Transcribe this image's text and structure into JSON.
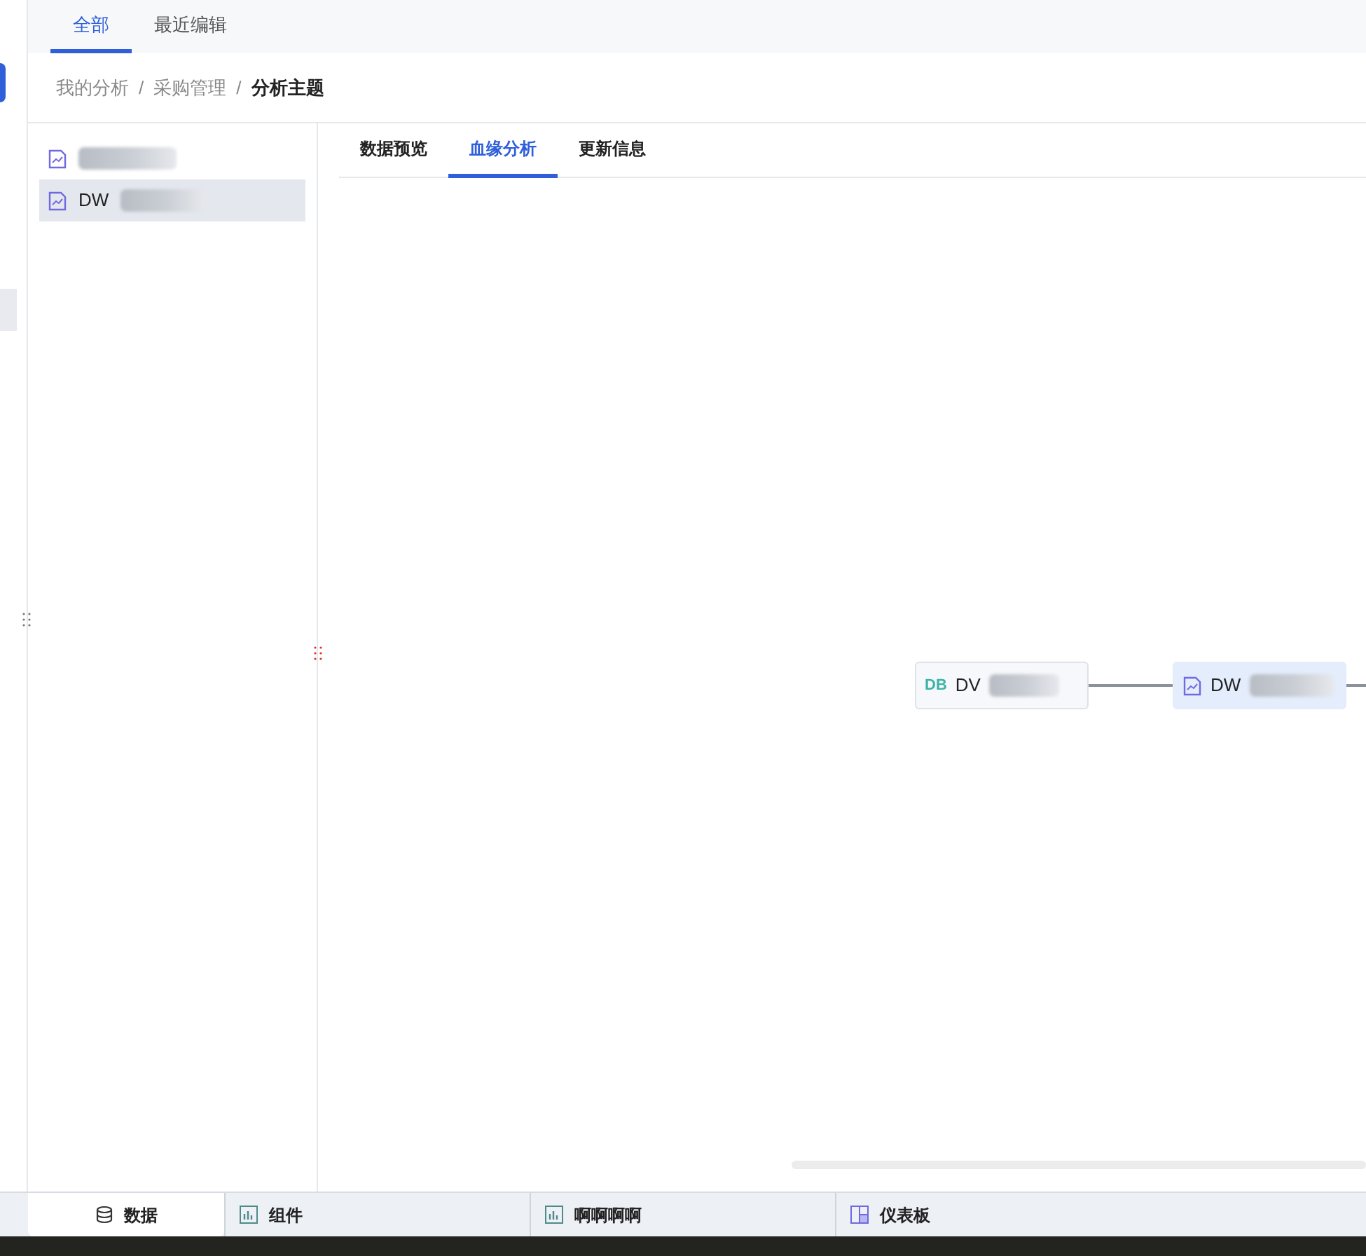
{
  "top_tabs": [
    {
      "label": "全部",
      "selected": true
    },
    {
      "label": "最近编辑",
      "selected": false
    }
  ],
  "breadcrumb": [
    {
      "label": "我的分析",
      "current": false
    },
    {
      "separator": "/",
      "label": "采购管理",
      "current": false
    },
    {
      "separator": "/",
      "label": "分析主题",
      "current": true
    }
  ],
  "list_items": [
    {
      "selected": false
    },
    {
      "label": "DW",
      "selected": true
    }
  ],
  "detail_tabs": [
    {
      "label": "数据预览",
      "selected": false
    },
    {
      "label": "血缘分析",
      "selected": true
    },
    {
      "label": "更新信息",
      "selected": false
    }
  ],
  "lineage_nodes": [
    {
      "kind": "table",
      "badge": "DB",
      "label": "DV",
      "selected": false
    },
    {
      "kind": "analysis",
      "label": "DW",
      "selected": true
    }
  ],
  "bottom_tabs": [
    {
      "kind": "database",
      "label": "数据",
      "selected": true
    },
    {
      "kind": "chart",
      "label": "组件",
      "selected": false
    },
    {
      "kind": "chart",
      "label": "啊啊啊啊",
      "selected": false
    },
    {
      "kind": "dashboard",
      "label": "仪表板",
      "selected": false
    }
  ]
}
